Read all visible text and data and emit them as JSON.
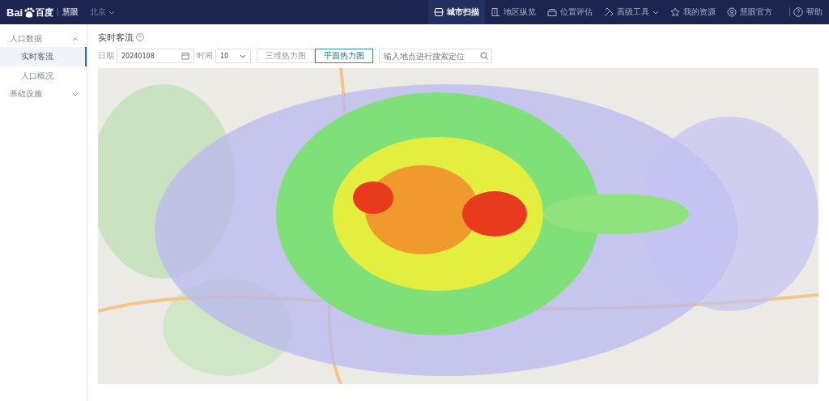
{
  "header": {
    "brand": "Bai",
    "brand_cn": "百度",
    "product": "慧眼",
    "city": "北京",
    "nav": [
      {
        "label": "城市扫描",
        "selected": true,
        "dropdown": false
      },
      {
        "label": "地区纵览",
        "selected": false,
        "dropdown": false
      },
      {
        "label": "位置评估",
        "selected": false,
        "dropdown": false
      },
      {
        "label": "高级工具",
        "selected": false,
        "dropdown": true
      },
      {
        "label": "我的资源",
        "selected": false,
        "dropdown": false
      },
      {
        "label": "慧眼官方",
        "selected": false,
        "dropdown": false
      }
    ],
    "help": "帮助"
  },
  "sidebar": {
    "groups": [
      {
        "label": "人口数据",
        "expanded": true,
        "children": [
          {
            "label": "实时客流",
            "selected": true
          },
          {
            "label": "人口概况",
            "selected": false
          }
        ]
      },
      {
        "label": "基础设施",
        "expanded": false
      }
    ]
  },
  "page": {
    "title": "实时客流",
    "toolbar": {
      "date_label": "日期",
      "date": "20240108",
      "time_label": "时间",
      "time": "10",
      "modes": [
        {
          "label": "三维热力图",
          "selected": false
        },
        {
          "label": "平面热力图",
          "selected": true
        }
      ],
      "search_placeholder": "输入地点进行搜索定位"
    }
  }
}
